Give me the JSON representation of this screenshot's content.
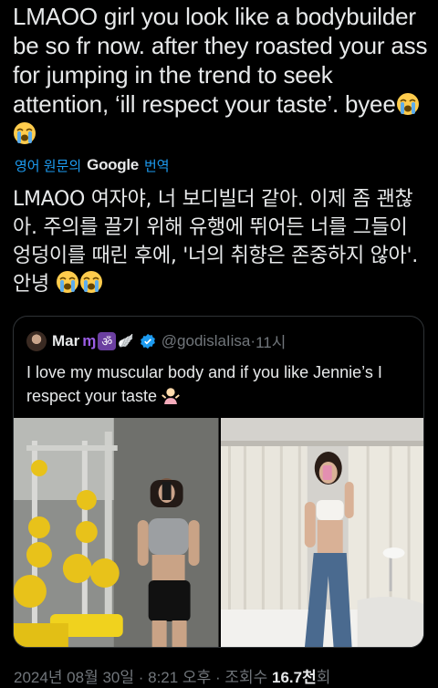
{
  "tweet": {
    "text": "LMAOO girl you look like a bodybuilder be so fr now. after they roasted your ass for jumping in the trend to seek attention, ‘ill respect your taste’. byee",
    "emoji_icon": "loudly-crying-face"
  },
  "translate": {
    "prefix": "영어 원문의",
    "google": "Google",
    "suffix": "번역"
  },
  "translation": {
    "text": "LMAOO 여자야, 너 보디빌더 같아. 이제 좀 괜찮아. 주의를 끌기 위해 유행에 뛰어든 너를 그들이 엉덩이를 때린 후에, '너의 취향은 존중하지 않아'. 안녕"
  },
  "quoted": {
    "name": "Mar",
    "badges": [
      "ɱ",
      "ॐ",
      "🪽"
    ],
    "handle": "@godislaIisa",
    "separator": " · ",
    "time": "11시",
    "text": "I love my muscular body and if you like Jennie’s I respect your taste",
    "text_emoji": "person-shrugging",
    "photos": [
      "gym-mirror-selfie",
      "bedroom-mirror-selfie"
    ]
  },
  "meta": {
    "date": "2024년 08월 30일",
    "dot1": " · ",
    "time": "8:21 오후",
    "dot2": " · ",
    "views_label": "조회수 ",
    "views_count": "16.7천",
    "views_suffix": "회"
  },
  "colors": {
    "background": "#000000",
    "text": "#e7e9ea",
    "muted": "#71767b",
    "link": "#1d9bf0",
    "border": "#2f3336",
    "verified": "#1d9bf0"
  }
}
